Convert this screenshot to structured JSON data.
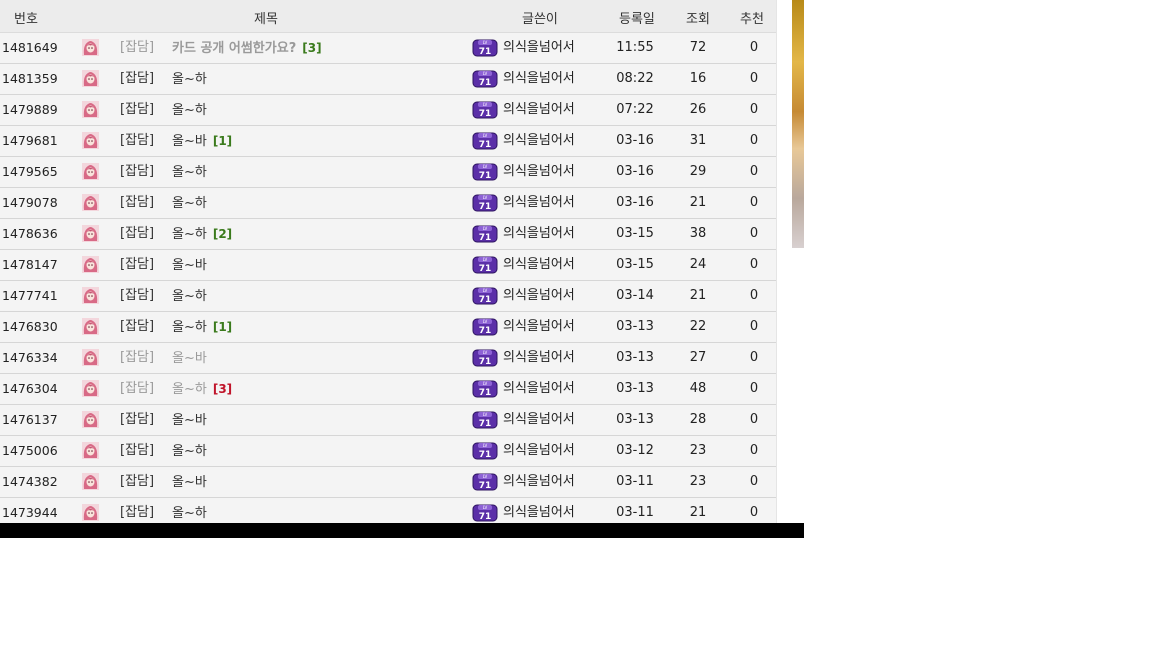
{
  "columns": {
    "number": "번호",
    "title": "제목",
    "author": "글쓴이",
    "date": "등록일",
    "views": "조회",
    "recommend": "추천"
  },
  "colors": {
    "level_badge": "#5b2fa8",
    "comment_green": "#3a7a1c",
    "comment_red": "#c0142a"
  },
  "icons": {
    "avatar": "pink-hair-avatar-icon",
    "badge": "level-badge-icon"
  },
  "rows": [
    {
      "num": "1481649",
      "cat": "[잡담]",
      "title": "카드 공개 어썸한가요?",
      "comments": "[3]",
      "cc": "green",
      "author": "의식을넘어서",
      "level": "71",
      "date": "11:55",
      "views": "72",
      "rec": "0",
      "style": "bold"
    },
    {
      "num": "1481359",
      "cat": "[잡담]",
      "title": "올~하",
      "comments": "",
      "cc": "",
      "author": "의식을넘어서",
      "level": "71",
      "date": "08:22",
      "views": "16",
      "rec": "0",
      "style": ""
    },
    {
      "num": "1479889",
      "cat": "[잡담]",
      "title": "올~하",
      "comments": "",
      "cc": "",
      "author": "의식을넘어서",
      "level": "71",
      "date": "07:22",
      "views": "26",
      "rec": "0",
      "style": ""
    },
    {
      "num": "1479681",
      "cat": "[잡담]",
      "title": "올~바",
      "comments": "[1]",
      "cc": "green",
      "author": "의식을넘어서",
      "level": "71",
      "date": "03-16",
      "views": "31",
      "rec": "0",
      "style": ""
    },
    {
      "num": "1479565",
      "cat": "[잡담]",
      "title": "올~하",
      "comments": "",
      "cc": "",
      "author": "의식을넘어서",
      "level": "71",
      "date": "03-16",
      "views": "29",
      "rec": "0",
      "style": ""
    },
    {
      "num": "1479078",
      "cat": "[잡담]",
      "title": "올~하",
      "comments": "",
      "cc": "",
      "author": "의식을넘어서",
      "level": "71",
      "date": "03-16",
      "views": "21",
      "rec": "0",
      "style": ""
    },
    {
      "num": "1478636",
      "cat": "[잡담]",
      "title": "올~하",
      "comments": "[2]",
      "cc": "green",
      "author": "의식을넘어서",
      "level": "71",
      "date": "03-15",
      "views": "38",
      "rec": "0",
      "style": ""
    },
    {
      "num": "1478147",
      "cat": "[잡담]",
      "title": "올~바",
      "comments": "",
      "cc": "",
      "author": "의식을넘어서",
      "level": "71",
      "date": "03-15",
      "views": "24",
      "rec": "0",
      "style": ""
    },
    {
      "num": "1477741",
      "cat": "[잡담]",
      "title": "올~하",
      "comments": "",
      "cc": "",
      "author": "의식을넘어서",
      "level": "71",
      "date": "03-14",
      "views": "21",
      "rec": "0",
      "style": ""
    },
    {
      "num": "1476830",
      "cat": "[잡담]",
      "title": "올~하",
      "comments": "[1]",
      "cc": "green",
      "author": "의식을넘어서",
      "level": "71",
      "date": "03-13",
      "views": "22",
      "rec": "0",
      "style": ""
    },
    {
      "num": "1476334",
      "cat": "[잡담]",
      "title": "올~바",
      "comments": "",
      "cc": "",
      "author": "의식을넘어서",
      "level": "71",
      "date": "03-13",
      "views": "27",
      "rec": "0",
      "style": "read"
    },
    {
      "num": "1476304",
      "cat": "[잡담]",
      "title": "올~하",
      "comments": "[3]",
      "cc": "red",
      "author": "의식을넘어서",
      "level": "71",
      "date": "03-13",
      "views": "48",
      "rec": "0",
      "style": "read"
    },
    {
      "num": "1476137",
      "cat": "[잡담]",
      "title": "올~바",
      "comments": "",
      "cc": "",
      "author": "의식을넘어서",
      "level": "71",
      "date": "03-13",
      "views": "28",
      "rec": "0",
      "style": ""
    },
    {
      "num": "1475006",
      "cat": "[잡담]",
      "title": "올~하",
      "comments": "",
      "cc": "",
      "author": "의식을넘어서",
      "level": "71",
      "date": "03-12",
      "views": "23",
      "rec": "0",
      "style": ""
    },
    {
      "num": "1474382",
      "cat": "[잡담]",
      "title": "올~바",
      "comments": "",
      "cc": "",
      "author": "의식을넘어서",
      "level": "71",
      "date": "03-11",
      "views": "23",
      "rec": "0",
      "style": ""
    },
    {
      "num": "1473944",
      "cat": "[잡담]",
      "title": "올~하",
      "comments": "",
      "cc": "",
      "author": "의식을넘어서",
      "level": "71",
      "date": "03-11",
      "views": "21",
      "rec": "0",
      "style": ""
    }
  ]
}
